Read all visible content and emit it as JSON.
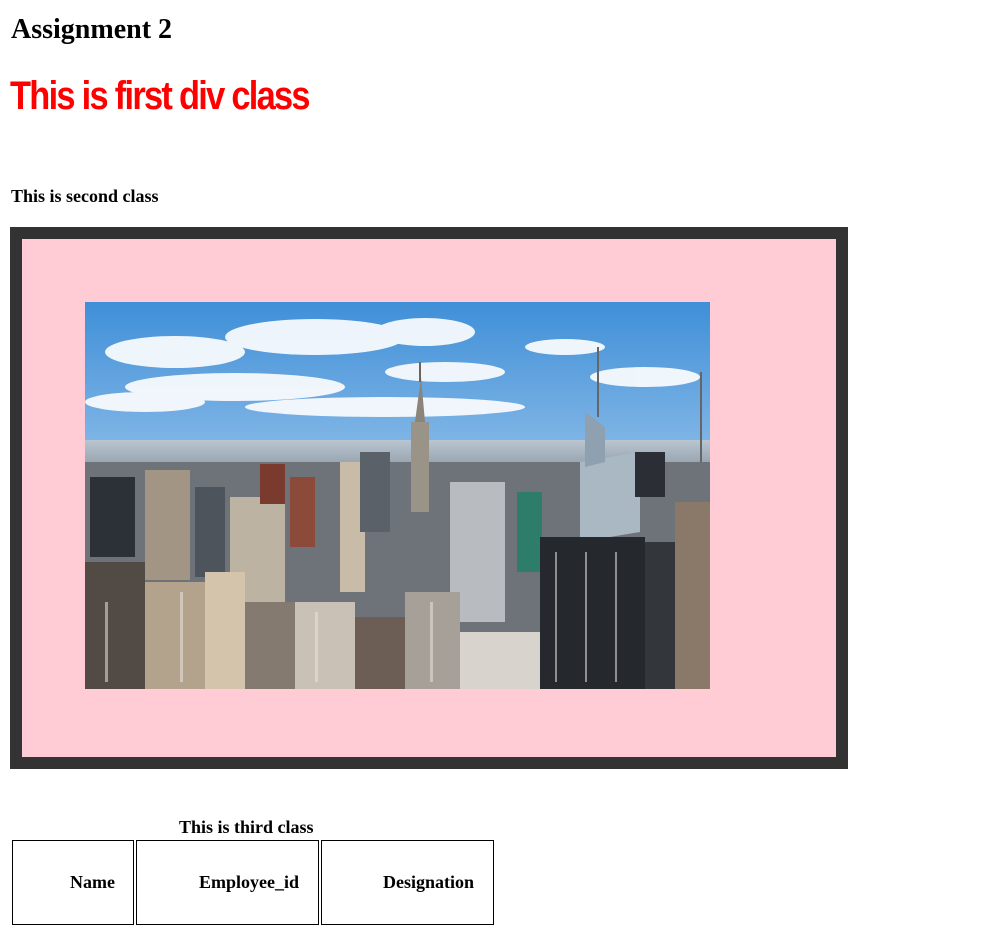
{
  "page": {
    "title": "Assignment 2"
  },
  "first_div": {
    "text": "This is first div class",
    "color": "#ff0000"
  },
  "second_div": {
    "text": "This is second class",
    "frame_border_color": "#333333",
    "frame_background": "#ffccd5",
    "image": "new-york-city-skyline-photo"
  },
  "third_div": {
    "text": "This is third class",
    "table": {
      "headers": [
        "Name",
        "Employee_id",
        "Designation"
      ]
    }
  }
}
